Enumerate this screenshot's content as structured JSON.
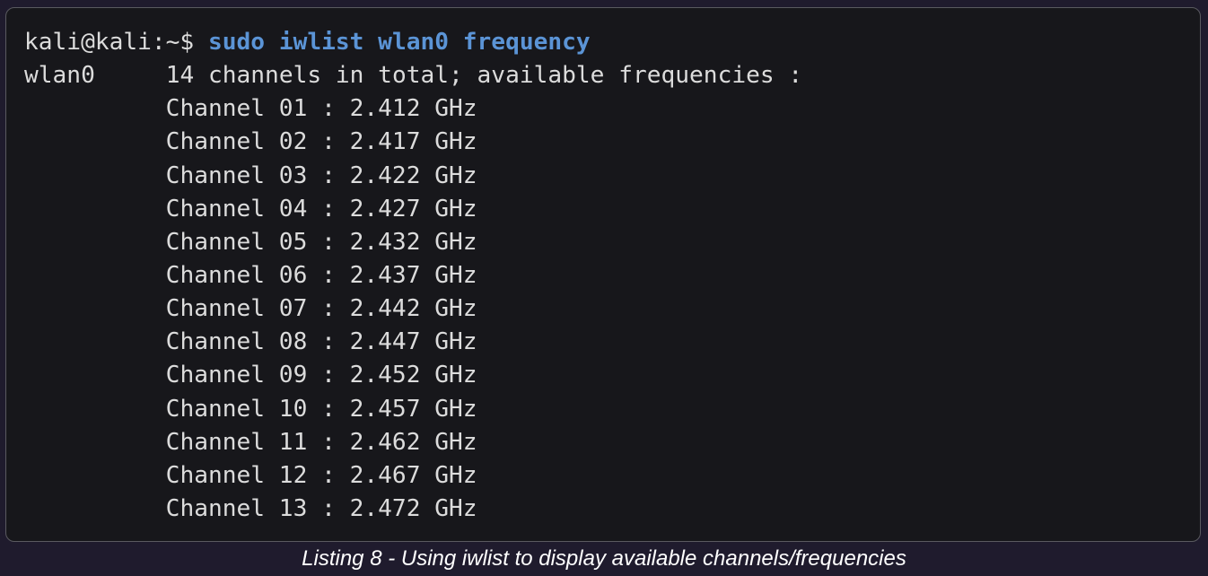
{
  "terminal": {
    "prompt": "kali@kali:~$",
    "command": "sudo iwlist wlan0 frequency",
    "header": {
      "interface": "wlan0",
      "summary": "14 channels in total; available frequencies :"
    },
    "channels": [
      "Channel 01 : 2.412 GHz",
      "Channel 02 : 2.417 GHz",
      "Channel 03 : 2.422 GHz",
      "Channel 04 : 2.427 GHz",
      "Channel 05 : 2.432 GHz",
      "Channel 06 : 2.437 GHz",
      "Channel 07 : 2.442 GHz",
      "Channel 08 : 2.447 GHz",
      "Channel 09 : 2.452 GHz",
      "Channel 10 : 2.457 GHz",
      "Channel 11 : 2.462 GHz",
      "Channel 12 : 2.467 GHz",
      "Channel 13 : 2.472 GHz"
    ]
  },
  "caption": "Listing 8 - Using iwlist to display available channels/frequencies",
  "colors": {
    "page_background": "#1f1b2d",
    "terminal_background": "#17171b",
    "command_text": "#5b94d6",
    "output_text": "#dcdcdc"
  }
}
